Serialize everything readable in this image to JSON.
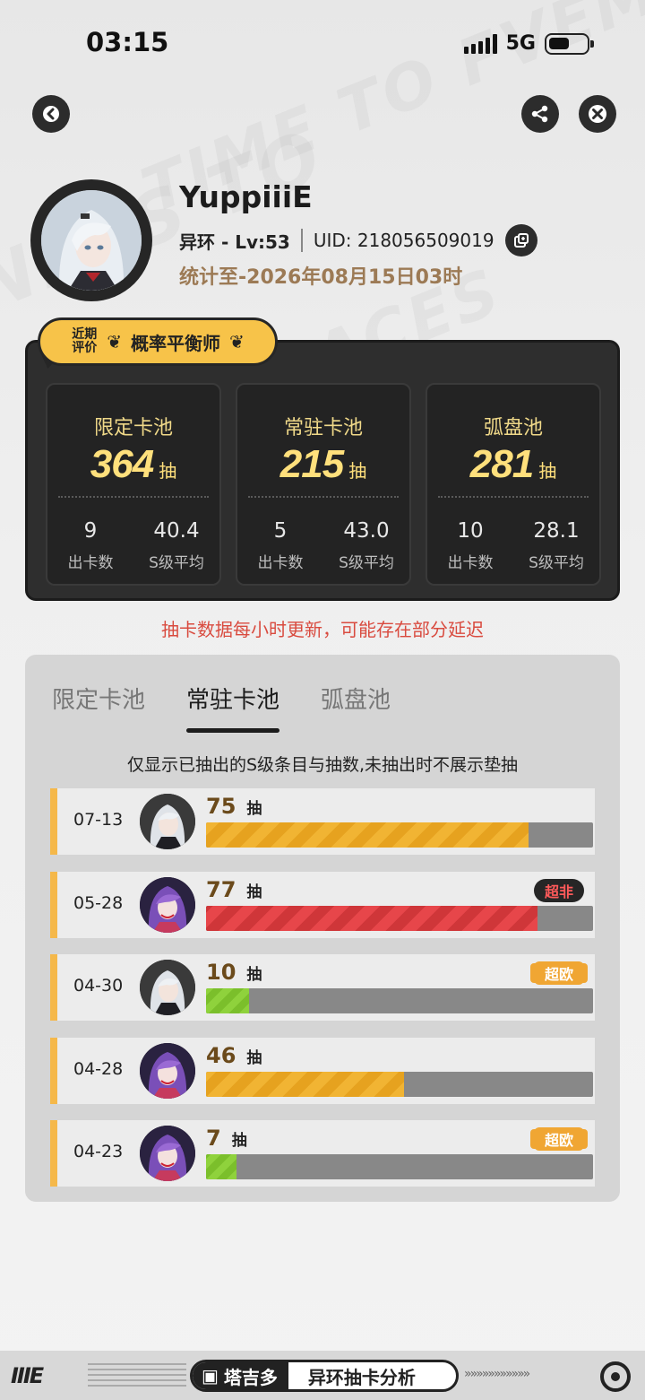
{
  "status_bar": {
    "time": "03:15",
    "network": "5G"
  },
  "profile": {
    "username": "YuppiiiE",
    "game_level": "异环 - Lv:53",
    "uid": "UID: 218056509019",
    "stat_date": "统计至-2026年08月15日03时"
  },
  "badge": {
    "small_label": "近期评价",
    "title": "概率平衡师"
  },
  "pools": [
    {
      "name": "限定卡池",
      "count": "364",
      "unit": "抽",
      "cards": "9",
      "cards_label": "出卡数",
      "avg": "40.4",
      "avg_label": "S级平均"
    },
    {
      "name": "常驻卡池",
      "count": "215",
      "unit": "抽",
      "cards": "5",
      "cards_label": "出卡数",
      "avg": "43.0",
      "avg_label": "S级平均"
    },
    {
      "name": "弧盘池",
      "count": "281",
      "unit": "抽",
      "cards": "10",
      "cards_label": "出卡数",
      "avg": "28.1",
      "avg_label": "S级平均"
    }
  ],
  "notice": "抽卡数据每小时更新，可能存在部分延迟",
  "tabs": [
    "限定卡池",
    "常驻卡池",
    "弧盘池"
  ],
  "active_tab": 1,
  "hint": "仅显示已抽出的S级条目与抽数,未抽出时不展示垫抽",
  "records": [
    {
      "date": "07-13",
      "pulls": "75",
      "unit": "抽",
      "max_pulls": 90,
      "tag": "",
      "style": "yellow",
      "character": "white-hair"
    },
    {
      "date": "05-28",
      "pulls": "77",
      "unit": "抽",
      "max_pulls": 90,
      "tag": "超非",
      "style": "red",
      "character": "purple-hair"
    },
    {
      "date": "04-30",
      "pulls": "10",
      "unit": "抽",
      "max_pulls": 90,
      "tag": "超欧",
      "style": "green",
      "character": "white-hair"
    },
    {
      "date": "04-28",
      "pulls": "46",
      "unit": "抽",
      "max_pulls": 90,
      "tag": "",
      "style": "yellow",
      "character": "purple-hair"
    },
    {
      "date": "04-23",
      "pulls": "7",
      "unit": "抽",
      "max_pulls": 90,
      "tag": "超欧",
      "style": "green",
      "character": "purple-hair"
    }
  ],
  "footer": {
    "brand": "塔吉多",
    "app_name": "异环抽卡分析",
    "logo": "IIIE"
  },
  "icons": {
    "back": "back-arrow-icon",
    "share": "share-icon",
    "close": "close-icon",
    "copy": "copy-icon"
  },
  "colors": {
    "accent_gold": "#ffe07c",
    "badge_yellow": "#f7c349",
    "notice_red": "#d94b3f",
    "bar_yellow": "#f1b433",
    "bar_red": "#e7464a",
    "bar_green": "#8fd23c"
  }
}
